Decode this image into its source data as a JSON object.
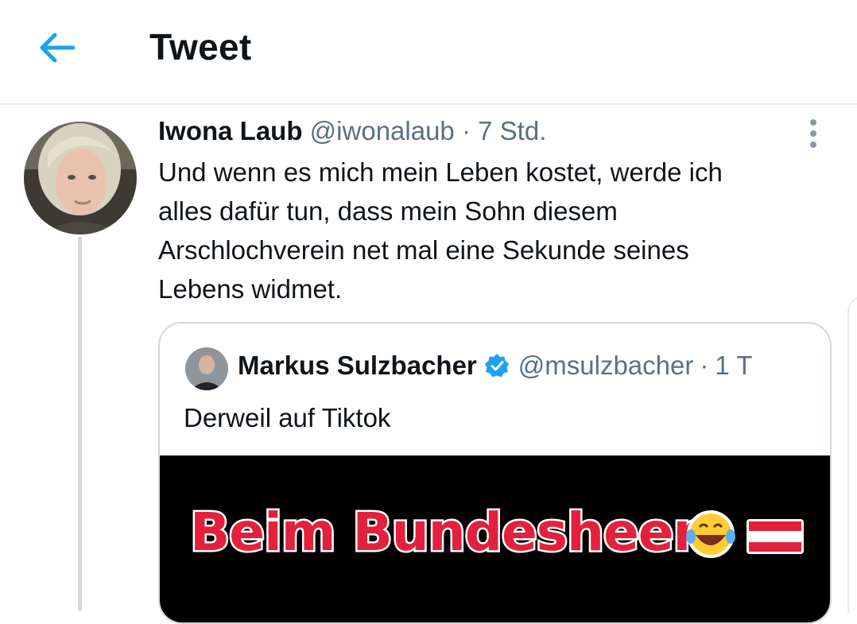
{
  "header": {
    "title": "Tweet",
    "back_icon": "arrow-left-icon"
  },
  "colors": {
    "accent": "#1da1f2",
    "muted": "#5b7083",
    "divider": "#e6ecf0",
    "caption_red": "#e3213d"
  },
  "tweet": {
    "author_name": "Iwona Laub",
    "handle": "@iwonalaub",
    "separator": "·",
    "time": "7 Std.",
    "text_lines": [
      "Und wenn es mich mein Leben kostet, werde ich",
      "alles dafür tun, dass mein Sohn diesem",
      "Arschlochverein net mal eine Sekunde seines",
      "Lebens widmet."
    ]
  },
  "quote": {
    "author_name": "Markus Sulzbacher",
    "verified": true,
    "handle": "@msulzbacher",
    "separator": "·",
    "time": "1 T",
    "text": "Derweil auf Tiktok",
    "media_caption": "Beim Bundesheer"
  }
}
